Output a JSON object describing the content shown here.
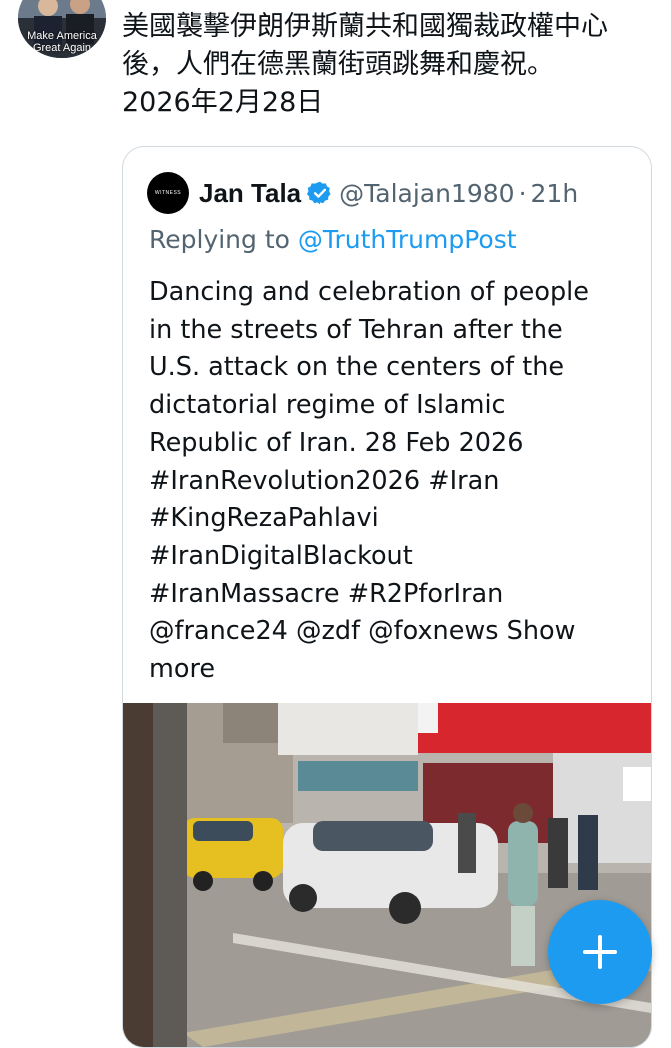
{
  "author_avatar": {
    "caption_line1": "Make America",
    "caption_line2": "Great Again"
  },
  "post": {
    "text_lines": [
      "美國襲擊伊朗伊斯蘭共和國獨裁政權中心",
      "後，人們在德黑蘭街頭跳舞和慶祝。",
      "2026年2月28日"
    ]
  },
  "quoted_post": {
    "avatar_text": "WITNESS",
    "author_name": "Jan Tala",
    "verified_icon": "verified-badge-icon",
    "handle": "@Talajan1980",
    "separator": "·",
    "time": "21h",
    "replying_prefix": "Replying to",
    "replying_to": "@TruthTrumpPost",
    "body_lines": [
      "Dancing and celebration of people",
      "in the streets of Tehran after the",
      "U.S. attack on the centers of the",
      "dictatorial regime of Islamic",
      "Republic of Iran. 28 Feb 2026",
      "#IranRevolution2026 #Iran",
      "#KingRezaPahlavi",
      "#IranDigitalBlackout",
      "#IranMassacre #R2PforIran",
      "@france24 @zdf @foxnews Show",
      "more"
    ],
    "media": {
      "type": "video-thumbnail",
      "description_icon": "street-video-icon"
    }
  },
  "compose_button": {
    "icon": "plus-icon"
  },
  "colors": {
    "accent": "#1d9bf0",
    "text": "#0f1419",
    "secondary_text": "#536471",
    "border": "#cfd9de"
  }
}
